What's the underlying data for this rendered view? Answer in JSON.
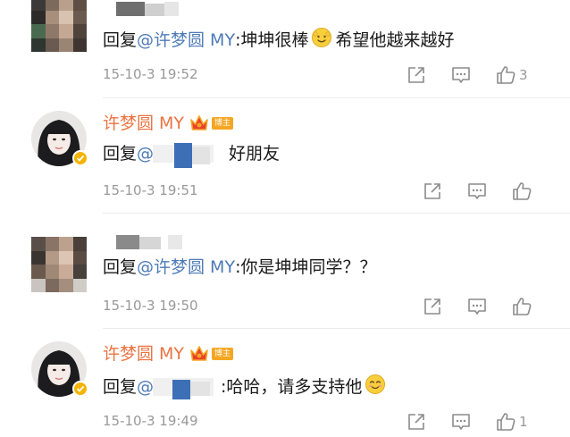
{
  "colors": {
    "username": "#eb7340",
    "mention": "#4e7bb8",
    "text": "#1a1a1a",
    "meta": "#999999",
    "badge": "#f5a623"
  },
  "comments": [
    {
      "user": "",
      "avatar": "pixelated-avatar",
      "reply_prefix": "回复",
      "mention": "@许梦圆 MY",
      "text": ":坤坤很棒",
      "emoji": "smile-emoji",
      "text_after_emoji": "希望他越来越好",
      "timestamp": "15-10-3 19:52",
      "likes": "3"
    },
    {
      "user": "许梦圆 MY",
      "avatar": "woman-avatar",
      "crown_icon": "crown-icon",
      "badge": "博主",
      "reply_prefix": "回复",
      "mention": "@",
      "text": "好朋友",
      "timestamp": "15-10-3 19:51",
      "likes": ""
    },
    {
      "user": "",
      "avatar": "pixelated-avatar",
      "reply_prefix": "回复",
      "mention": "@许梦圆 MY",
      "text": ":你是坤坤同学？？",
      "timestamp": "15-10-3 19:50",
      "likes": ""
    },
    {
      "user": "许梦圆 MY",
      "avatar": "woman-avatar",
      "crown_icon": "crown-icon",
      "badge": "博主",
      "reply_prefix": "回复",
      "mention": "@",
      "text": ":哈哈，请多支持他",
      "emoji": "blush-emoji",
      "timestamp": "15-10-3 19:49",
      "likes": "1"
    }
  ]
}
